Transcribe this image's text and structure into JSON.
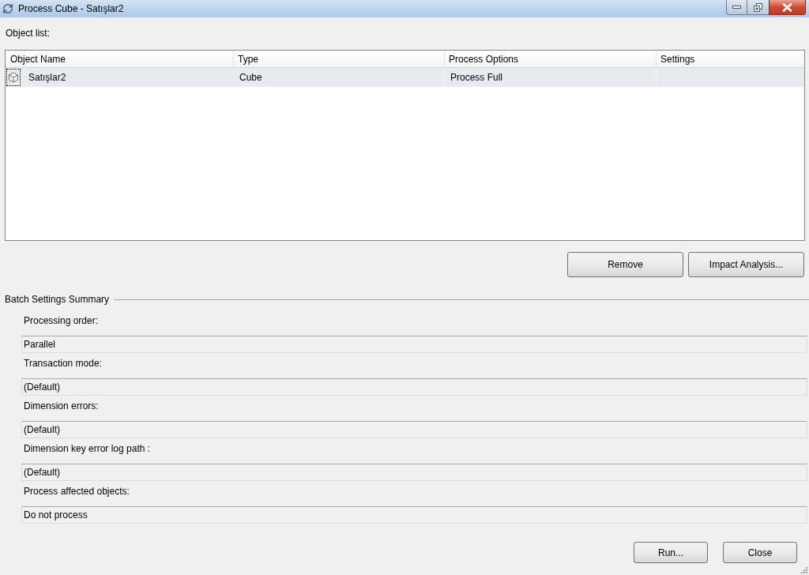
{
  "window": {
    "title": "Process Cube - Satışlar2"
  },
  "object_list": {
    "label": "Object list:",
    "columns": [
      "Object Name",
      "Type",
      "Process Options",
      "Settings"
    ],
    "rows": [
      {
        "object_name": "Satışlar2",
        "type": "Cube",
        "process_options": "Process Full",
        "selected": true
      }
    ]
  },
  "list_buttons": [
    "Remove",
    "Impact Analysis..."
  ],
  "batch_settings_summary": {
    "title": "Batch Settings Summary",
    "fields": [
      {
        "label": "Processing order:",
        "value": "Parallel"
      },
      {
        "label": "Transaction mode:",
        "value": "(Default)"
      },
      {
        "label": "Dimension errors:",
        "value": "(Default)"
      },
      {
        "label": "Dimension key error log path :",
        "value": "(Default)"
      },
      {
        "label": "Process affected objects:",
        "value": "Do not process"
      }
    ]
  },
  "footer_buttons": [
    "Run...",
    "Close"
  ]
}
